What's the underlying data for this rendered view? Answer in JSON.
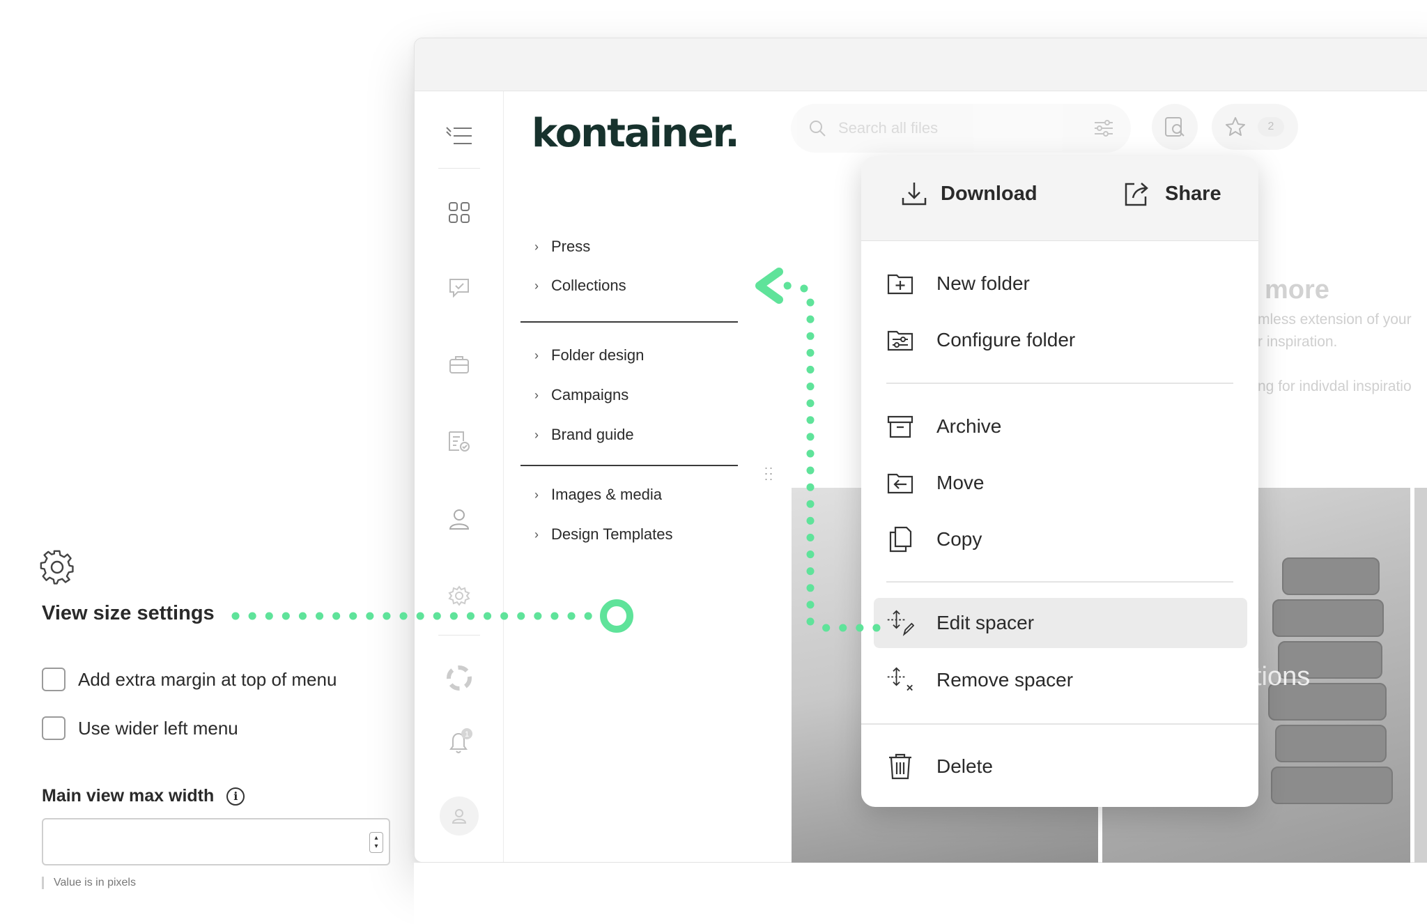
{
  "colors": {
    "accent": "#5fe39a",
    "brand": "#17322d",
    "text": "#2a2a2a"
  },
  "logo": "kontainer.",
  "rail": {
    "icons": [
      "collapse-menu-icon",
      "grid-icon",
      "chat-check-icon",
      "briefcase-icon",
      "document-check-icon",
      "user-icon",
      "gear-icon",
      "lifebuoy-icon",
      "bell-icon",
      "profile-icon"
    ],
    "notification_count": "1"
  },
  "nav": {
    "items": [
      "Press",
      "Collections",
      "Folder design",
      "Campaigns",
      "Brand guide",
      "Images & media",
      "Design Templates"
    ]
  },
  "search": {
    "placeholder": "Search all files"
  },
  "favorites": {
    "count": "2"
  },
  "promo": {
    "title": "more",
    "line1": "mless extension of your",
    "line2": "r inspiration.",
    "line3": "ng for indivdal inspiratio"
  },
  "gallery": {
    "label": "tions"
  },
  "menu": {
    "download": "Download",
    "share": "Share",
    "new_folder": "New folder",
    "configure_folder": "Configure folder",
    "archive": "Archive",
    "move": "Move",
    "copy": "Copy",
    "edit_spacer": "Edit spacer",
    "remove_spacer": "Remove spacer",
    "delete": "Delete"
  },
  "settings": {
    "title": "View size settings",
    "option1": "Add extra margin at top of menu",
    "option2": "Use wider left menu",
    "max_width_label": "Main view max width",
    "max_width_value": "",
    "help": "Value is in pixels"
  }
}
